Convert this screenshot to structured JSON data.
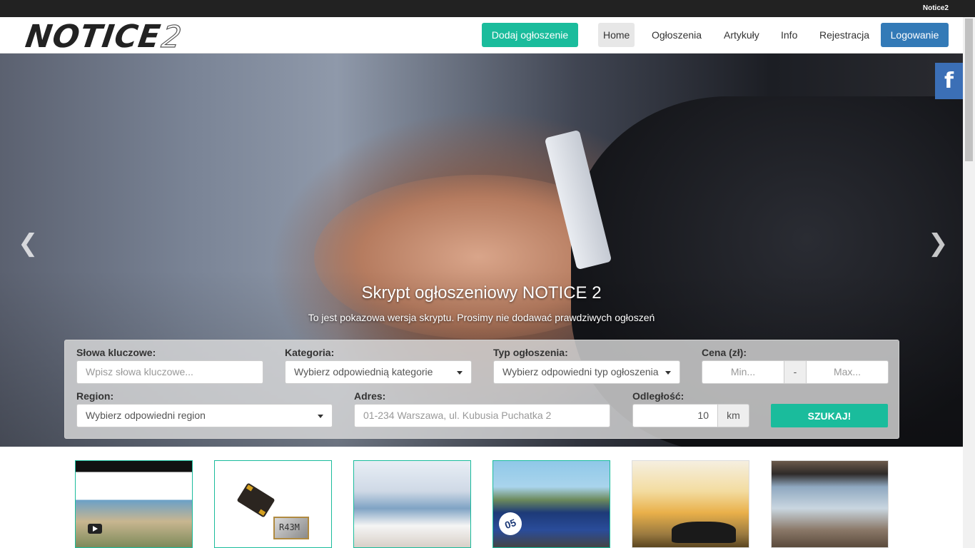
{
  "topbar": {
    "title": "Notice2"
  },
  "navbar": {
    "logo_text": "NOTICE",
    "logo_suffix": "2",
    "add_button": "Dodaj ogłoszenie",
    "links": [
      "Home",
      "Ogłoszenia",
      "Artykuły",
      "Info",
      "Rejestracja"
    ],
    "login_button": "Logowanie"
  },
  "hero": {
    "title": "Skrypt ogłoszeniowy NOTICE 2",
    "subtitle": "To jest pokazowa wersja skryptu. Prosimy nie dodawać prawdziwych ogłoszeń",
    "prev_arrow": "❮",
    "next_arrow": "❯",
    "facebook_glyph": "f"
  },
  "search": {
    "keywords_label": "Słowa kluczowe:",
    "keywords_placeholder": "Wpisz słowa kluczowe...",
    "category_label": "Kategoria:",
    "category_value": "Wybierz odpowiednią kategorie",
    "type_label": "Typ ogłoszenia:",
    "type_value": "Wybierz odpowiedni typ ogłoszenia",
    "price_label": "Cena (zł):",
    "price_min_placeholder": "Min...",
    "price_separator": "-",
    "price_max_placeholder": "Max...",
    "region_label": "Region:",
    "region_value": "Wybierz odpowiedni region",
    "address_label": "Adres:",
    "address_placeholder": "01-234 Warszawa, ul. Kubusia Puchatka 2",
    "distance_label": "Odległość:",
    "distance_value": "10",
    "distance_unit": "km",
    "submit_button": "SZUKAJ!"
  },
  "thumbnails": {
    "crystal_text": "R43M",
    "car_number": "05"
  },
  "colors": {
    "accent": "#1abc9c",
    "primary": "#337ab7",
    "topbar": "#222222",
    "facebook": "#3b6fb6"
  }
}
